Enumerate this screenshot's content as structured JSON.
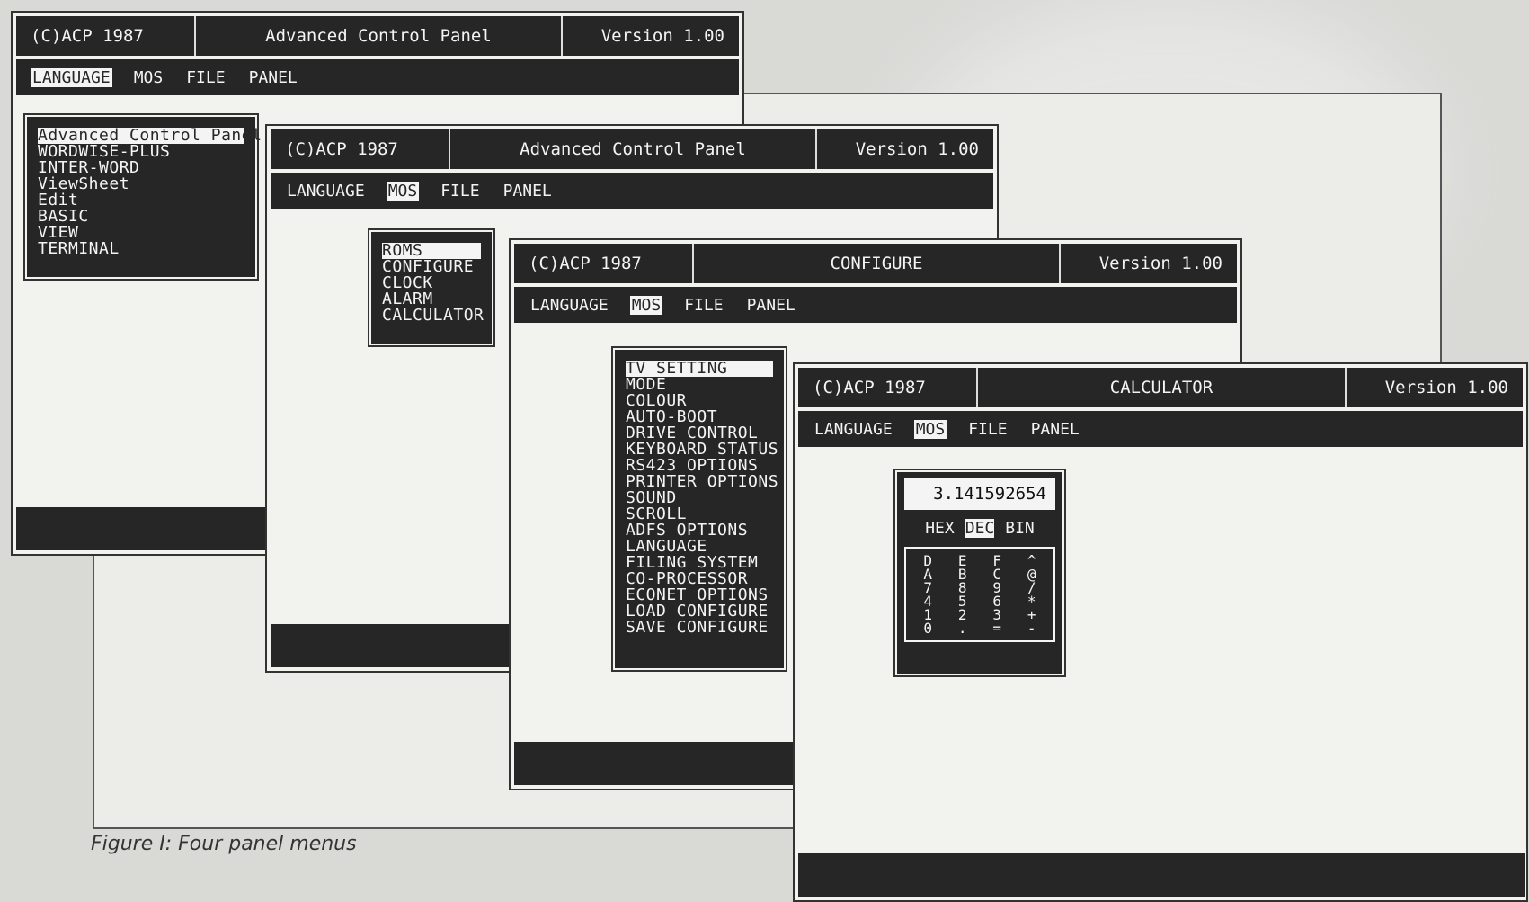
{
  "caption": "Figure I: Four panel menus",
  "windows": {
    "w1": {
      "copyright": "(C)ACP 1987",
      "title": "Advanced Control Panel",
      "version": "Version 1.00",
      "menu": [
        "LANGUAGE",
        "MOS",
        "FILE",
        "PANEL"
      ],
      "active_menu": "LANGUAGE",
      "dropdown": [
        "Advanced Control Panel",
        "WORDWISE-PLUS",
        "INTER-WORD",
        "ViewSheet",
        "Edit",
        "BASIC",
        "VIEW",
        "TERMINAL"
      ]
    },
    "w2": {
      "copyright": "(C)ACP 1987",
      "title": "Advanced Control Panel",
      "version": "Version 1.00",
      "menu": [
        "LANGUAGE",
        "MOS",
        "FILE",
        "PANEL"
      ],
      "active_menu": "MOS",
      "dropdown": [
        "ROMS",
        "CONFIGURE",
        "CLOCK",
        "ALARM",
        "CALCULATOR"
      ]
    },
    "w3": {
      "copyright": "(C)ACP 1987",
      "title": "CONFIGURE",
      "version": "Version 1.00",
      "menu": [
        "LANGUAGE",
        "MOS",
        "FILE",
        "PANEL"
      ],
      "active_menu": "MOS",
      "dropdown": [
        "TV SETTING",
        "MODE",
        "COLOUR",
        "AUTO-BOOT",
        "DRIVE CONTROL",
        "KEYBOARD STATUS",
        "RS423 OPTIONS",
        "PRINTER OPTIONS",
        "SOUND",
        "SCROLL",
        "ADFS OPTIONS",
        "LANGUAGE",
        "FILING SYSTEM",
        "CO-PROCESSOR",
        "ECONET OPTIONS",
        "LOAD CONFIGURE",
        "SAVE CONFIGURE"
      ]
    },
    "w4": {
      "copyright": "(C)ACP 1987",
      "title": "CALCULATOR",
      "version": "Version 1.00",
      "menu": [
        "LANGUAGE",
        "MOS",
        "FILE",
        "PANEL"
      ],
      "active_menu": "MOS",
      "calculator": {
        "display": "3.141592654",
        "bases": [
          "HEX",
          "DEC",
          "BIN"
        ],
        "active_base": "DEC",
        "keypad_columns": [
          [
            "D",
            "A",
            "7",
            "4",
            "1",
            "0"
          ],
          [
            "E",
            "B",
            "8",
            "5",
            "2",
            "."
          ],
          [
            "F",
            "C",
            "9",
            "6",
            "3",
            "="
          ],
          [
            "^",
            "@",
            "/",
            "*",
            "+",
            "-"
          ]
        ]
      }
    }
  }
}
